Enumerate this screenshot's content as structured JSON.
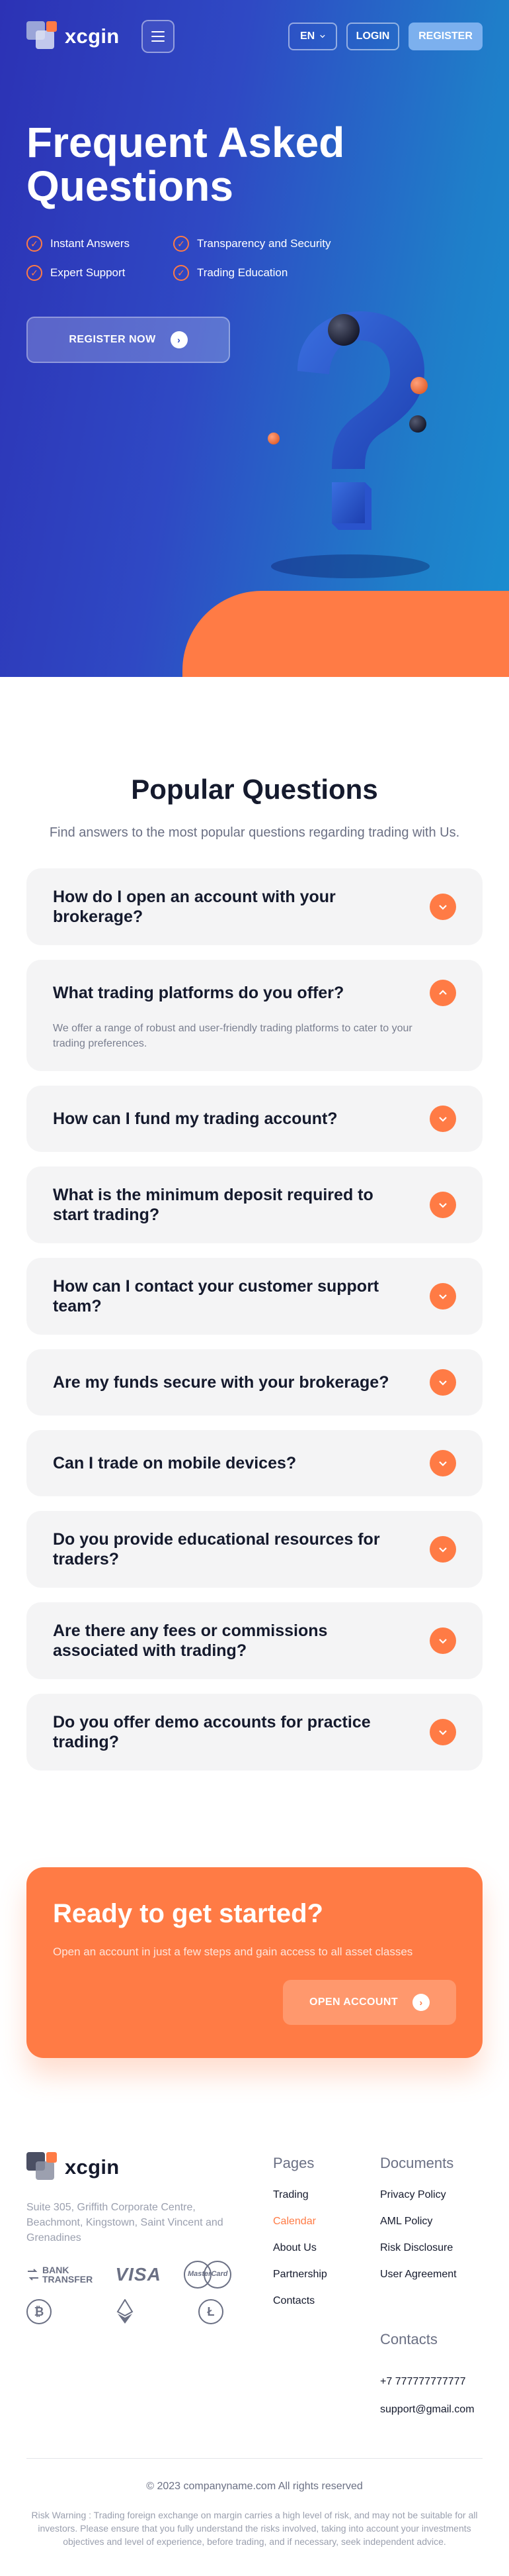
{
  "header": {
    "brand": "xcgin",
    "language": "EN",
    "login_label": "LOGIN",
    "register_label": "REGISTER"
  },
  "hero": {
    "title": "Frequent Asked Questions",
    "features": [
      "Instant Answers",
      "Transparency and Security",
      "Expert Support",
      "Trading Education"
    ],
    "cta_label": "REGISTER NOW"
  },
  "faq": {
    "title": "Popular Questions",
    "subtitle": "Find answers to the most popular questions regarding trading with Us.",
    "items": [
      {
        "question": "How do I open an account with your brokerage?"
      },
      {
        "question": "What trading platforms do you offer?",
        "answer": "We offer a range of robust and user-friendly trading platforms to cater to your trading preferences."
      },
      {
        "question": "How can I fund my trading account?"
      },
      {
        "question": "What is the minimum deposit required to start trading?"
      },
      {
        "question": "How can I contact your customer support team?"
      },
      {
        "question": "Are my funds secure with your brokerage?"
      },
      {
        "question": "Can I trade on mobile devices?"
      },
      {
        "question": "Do you provide educational resources for traders?"
      },
      {
        "question": "Are there any fees or commissions associated with trading?"
      },
      {
        "question": "Do you offer demo accounts for practice trading?"
      }
    ]
  },
  "cta": {
    "title": "Ready to get started?",
    "text": "Open an account in just a few steps and gain access to all asset classes",
    "button_label": "OPEN ACCOUNT"
  },
  "footer": {
    "brand": "xcgin",
    "address": "Suite 305, Griffith Corporate Centre, Beachmont, Kingstown, Saint Vincent and Grenadines",
    "payment_labels": {
      "bank_line1": "BANK",
      "bank_line2": "TRANSFER",
      "visa": "VISA",
      "mastercard": "MasterCard"
    },
    "pages_title": "Pages",
    "pages": [
      "Trading",
      "Calendar",
      "About Us",
      "Partnership",
      "Contacts"
    ],
    "documents_title": "Documents",
    "documents": [
      "Privacy Policy",
      "AML Policy",
      "Risk Disclosure",
      "User Agreement"
    ],
    "contacts_title": "Contacts",
    "phone": "+7 777777777777",
    "email": "support@gmail.com",
    "copyright": "© 2023 companyname.com All rights reserved",
    "risk_warning": "Risk Warning : Trading foreign exchange on margin carries a high level of risk, and may not be suitable for all investors. Please ensure that you fully understand the risks involved, taking into account your investments objectives and level of experience, before trading, and if necessary, seek independent advice."
  },
  "colors": {
    "accent": "#ff7b45",
    "hero_gradient_start": "#2c32b5",
    "hero_gradient_end": "#1a8ed0",
    "dark_text": "#151a2d",
    "card_bg": "#f4f4f5"
  },
  "icons": {
    "menu": "hamburger-icon",
    "language": "chevron-down-icon",
    "feature": "check-circle-icon",
    "faq_collapsed": "chevron-down-icon",
    "faq_expanded": "chevron-up-icon",
    "cta_arrow": "arrow-right-circle-icon",
    "crypto": [
      "bitcoin-icon",
      "ethereum-icon",
      "litecoin-icon"
    ]
  }
}
